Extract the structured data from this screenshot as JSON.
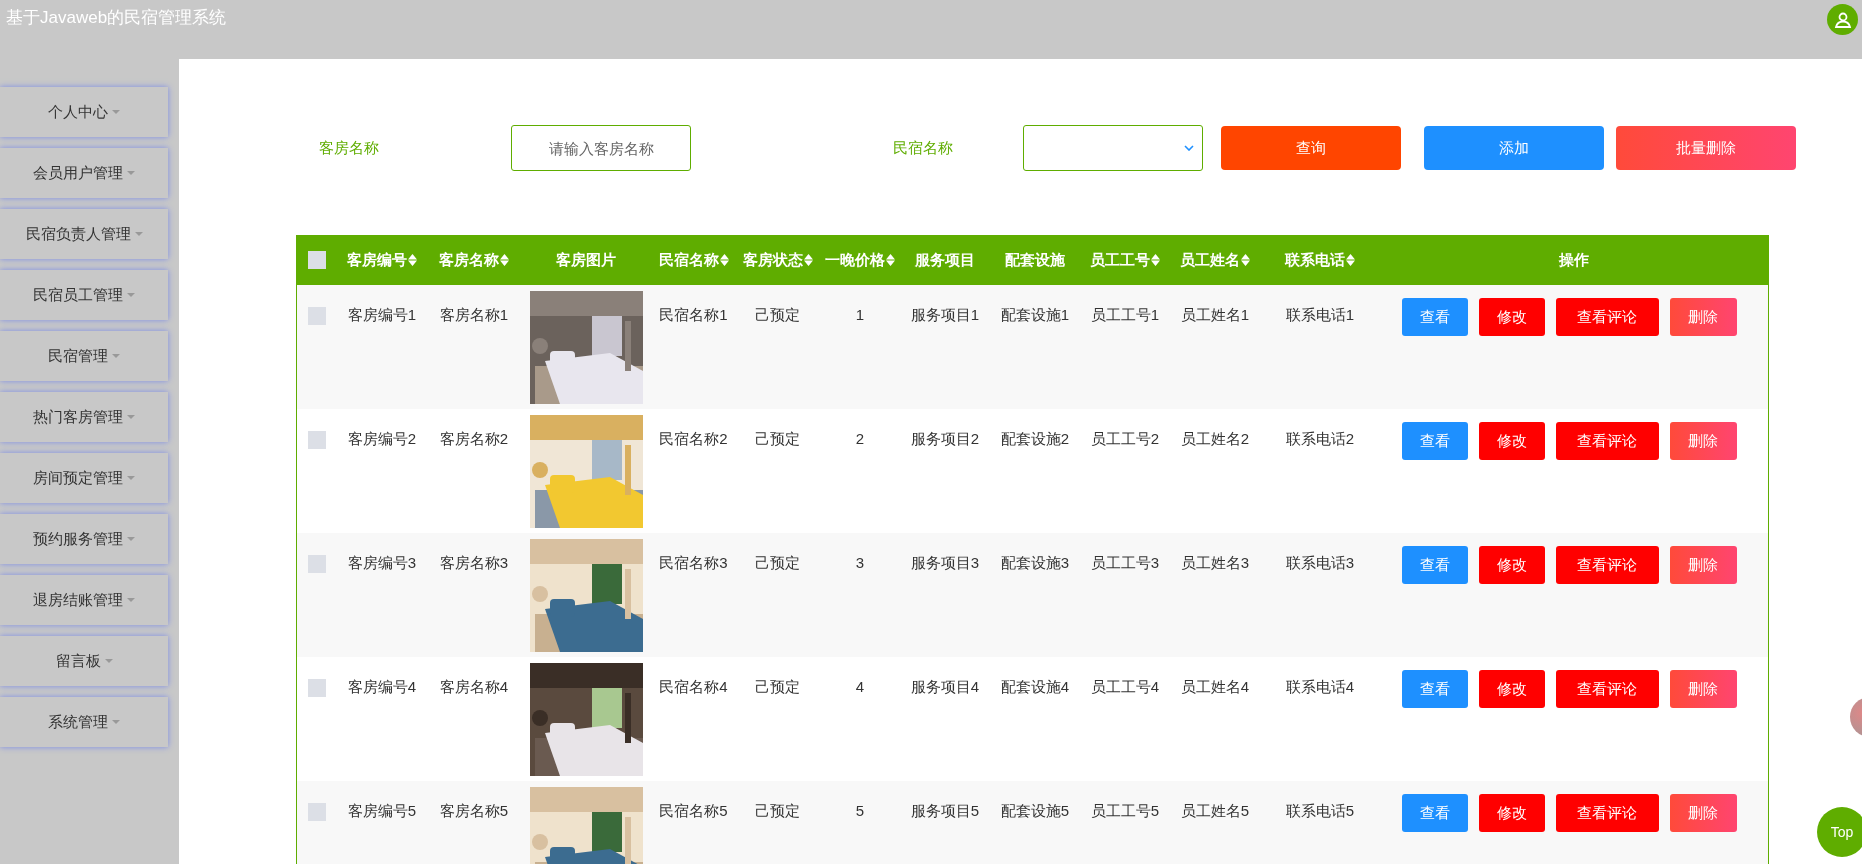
{
  "header": {
    "title": "基于Javaweb的民宿管理系统"
  },
  "sidebar": {
    "items": [
      {
        "label": "个人中心"
      },
      {
        "label": "会员用户管理"
      },
      {
        "label": "民宿负责人管理"
      },
      {
        "label": "民宿员工管理"
      },
      {
        "label": "民宿管理"
      },
      {
        "label": "热门客房管理"
      },
      {
        "label": "房间预定管理"
      },
      {
        "label": "预约服务管理"
      },
      {
        "label": "退房结账管理"
      },
      {
        "label": "留言板"
      },
      {
        "label": "系统管理"
      }
    ]
  },
  "search": {
    "room_name_label": "客房名称",
    "room_name_placeholder": "请输入客房名称",
    "homestay_label": "民宿名称",
    "buttons": [
      {
        "label": "查询",
        "kind": "query"
      },
      {
        "label": "添加",
        "kind": "add"
      },
      {
        "label": "批量删除",
        "kind": "bulk-delete"
      }
    ]
  },
  "table": {
    "select_all_checked": false,
    "columns": [
      {
        "label": "客房编号",
        "sortable": true
      },
      {
        "label": "客房名称",
        "sortable": true
      },
      {
        "label": "客房图片"
      },
      {
        "label": "民宿名称",
        "sortable": true
      },
      {
        "label": "客房状态",
        "sortable": true
      },
      {
        "label": "一晚价格",
        "sortable": true
      },
      {
        "label": "服务项目"
      },
      {
        "label": "配套设施"
      },
      {
        "label": "员工工号",
        "sortable": true
      },
      {
        "label": "员工姓名",
        "sortable": true
      },
      {
        "label": "联系电话",
        "sortable": true
      },
      {
        "label": "操作"
      }
    ],
    "rows": [
      {
        "checked": false,
        "cells": [
          "客房编号1",
          "客房名称1",
          {
            "kind": "picture"
          },
          "民宿名称1",
          "己预定",
          "1",
          "服务项目1",
          "配套设施1",
          "员工工号1",
          "员工姓名1",
          "联系电话1"
        ],
        "actions": [
          {
            "label": "查看",
            "kind": "view"
          },
          {
            "label": "修改",
            "kind": "edit"
          },
          {
            "label": "查看评论",
            "kind": "comments"
          },
          {
            "label": "删除",
            "kind": "delete"
          }
        ]
      },
      {
        "checked": false,
        "cells": [
          "客房编号2",
          "客房名称2",
          {
            "kind": "picture"
          },
          "民宿名称2",
          "己预定",
          "2",
          "服务项目2",
          "配套设施2",
          "员工工号2",
          "员工姓名2",
          "联系电话2"
        ],
        "actions": [
          {
            "label": "查看",
            "kind": "view"
          },
          {
            "label": "修改",
            "kind": "edit"
          },
          {
            "label": "查看评论",
            "kind": "comments"
          },
          {
            "label": "删除",
            "kind": "delete"
          }
        ]
      },
      {
        "checked": false,
        "cells": [
          "客房编号3",
          "客房名称3",
          {
            "kind": "picture"
          },
          "民宿名称3",
          "己预定",
          "3",
          "服务项目3",
          "配套设施3",
          "员工工号3",
          "员工姓名3",
          "联系电话3"
        ],
        "actions": [
          {
            "label": "查看",
            "kind": "view"
          },
          {
            "label": "修改",
            "kind": "edit"
          },
          {
            "label": "查看评论",
            "kind": "comments"
          },
          {
            "label": "删除",
            "kind": "delete"
          }
        ]
      },
      {
        "checked": false,
        "cells": [
          "客房编号4",
          "客房名称4",
          {
            "kind": "picture"
          },
          "民宿名称4",
          "己预定",
          "4",
          "服务项目4",
          "配套设施4",
          "员工工号4",
          "员工姓名4",
          "联系电话4"
        ],
        "actions": [
          {
            "label": "查看",
            "kind": "view"
          },
          {
            "label": "修改",
            "kind": "edit"
          },
          {
            "label": "查看评论",
            "kind": "comments"
          },
          {
            "label": "删除",
            "kind": "delete"
          }
        ]
      },
      {
        "checked": false,
        "cells": [
          "客房编号5",
          "客房名称5",
          {
            "kind": "picture"
          },
          "民宿名称5",
          "己预定",
          "5",
          "服务项目5",
          "配套设施5",
          "员工工号5",
          "员工姓名5",
          "联系电话5"
        ],
        "actions": [
          {
            "label": "查看",
            "kind": "view"
          },
          {
            "label": "修改",
            "kind": "edit"
          },
          {
            "label": "查看评论",
            "kind": "comments"
          },
          {
            "label": "删除",
            "kind": "delete"
          }
        ]
      }
    ]
  },
  "back_to_top": {
    "label": "Top"
  }
}
